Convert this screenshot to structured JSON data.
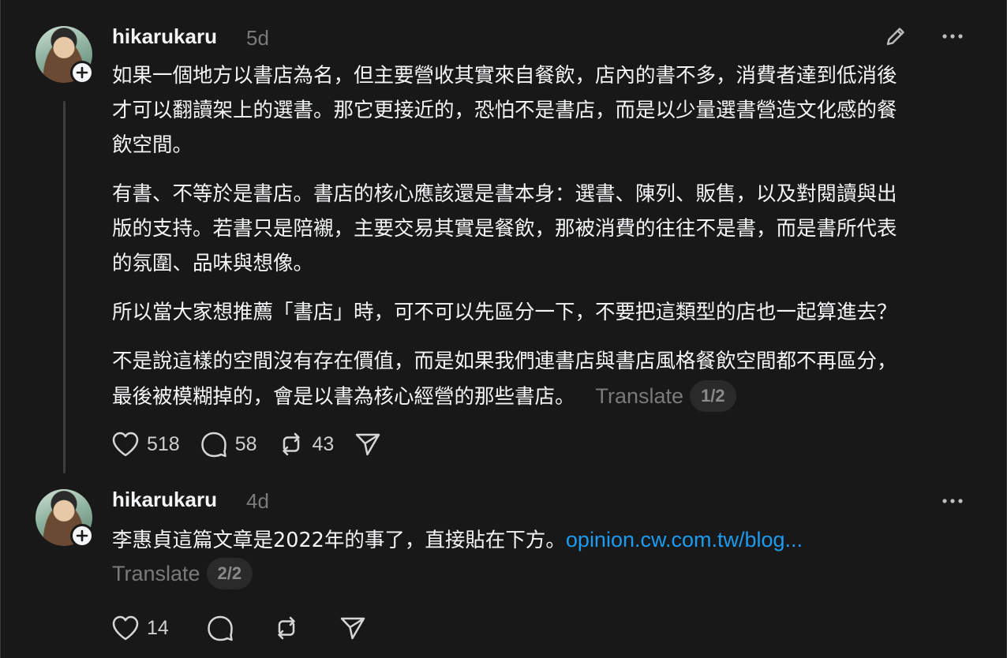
{
  "posts": [
    {
      "username": "hikarukaru",
      "time": "5d",
      "paragraphs": [
        "如果一個地方以書店為名，但主要營收其實來自餐飲，店內的書不多，消費者達到低消後\n才可以翻讀架上的選書。那它更接近的，恐怕不是書店，而是以少量選書營造文化感的餐\n飲空間。",
        "有書、不等於是書店。書店的核心應該還是書本身：選書、陳列、販售，以及對閱讀與出\n版的支持。若書只是陪襯，主要交易其實是餐飲，那被消費的往往不是書，而是書所代表\n的氛圍、品味與想像。",
        "所以當大家想推薦「書店」時，可不可以先區分一下，不要把這類型的店也一起算進去？",
        "不是說這樣的空間沒有存在價值，而是如果我們連書店與書店風格餐飲空間都不再區分，\n最後被模糊掉的，會是以書為核心經營的那些書店。"
      ],
      "translate_label": "Translate",
      "page_indicator": "1/2",
      "likes": "518",
      "comments": "58",
      "reposts": "43"
    },
    {
      "username": "hikarukaru",
      "time": "4d",
      "text": "李惠貞這篇文章是2022年的事了，直接貼在下方。",
      "link_text": "opinion.cw.com.tw/blog...",
      "translate_label": "Translate",
      "page_indicator": "2/2",
      "likes": "14"
    }
  ],
  "icons": {
    "avatar": "avatar-image",
    "follow": "plus-icon",
    "edit": "pencil-icon",
    "more": "more-horizontal-icon",
    "like": "heart-icon",
    "comment": "comment-icon",
    "repost": "repost-icon",
    "share": "send-icon"
  },
  "colors": {
    "background": "#181818",
    "text": "#f3f5f7",
    "muted": "#7a7a7a",
    "link": "#1d9bf0"
  }
}
